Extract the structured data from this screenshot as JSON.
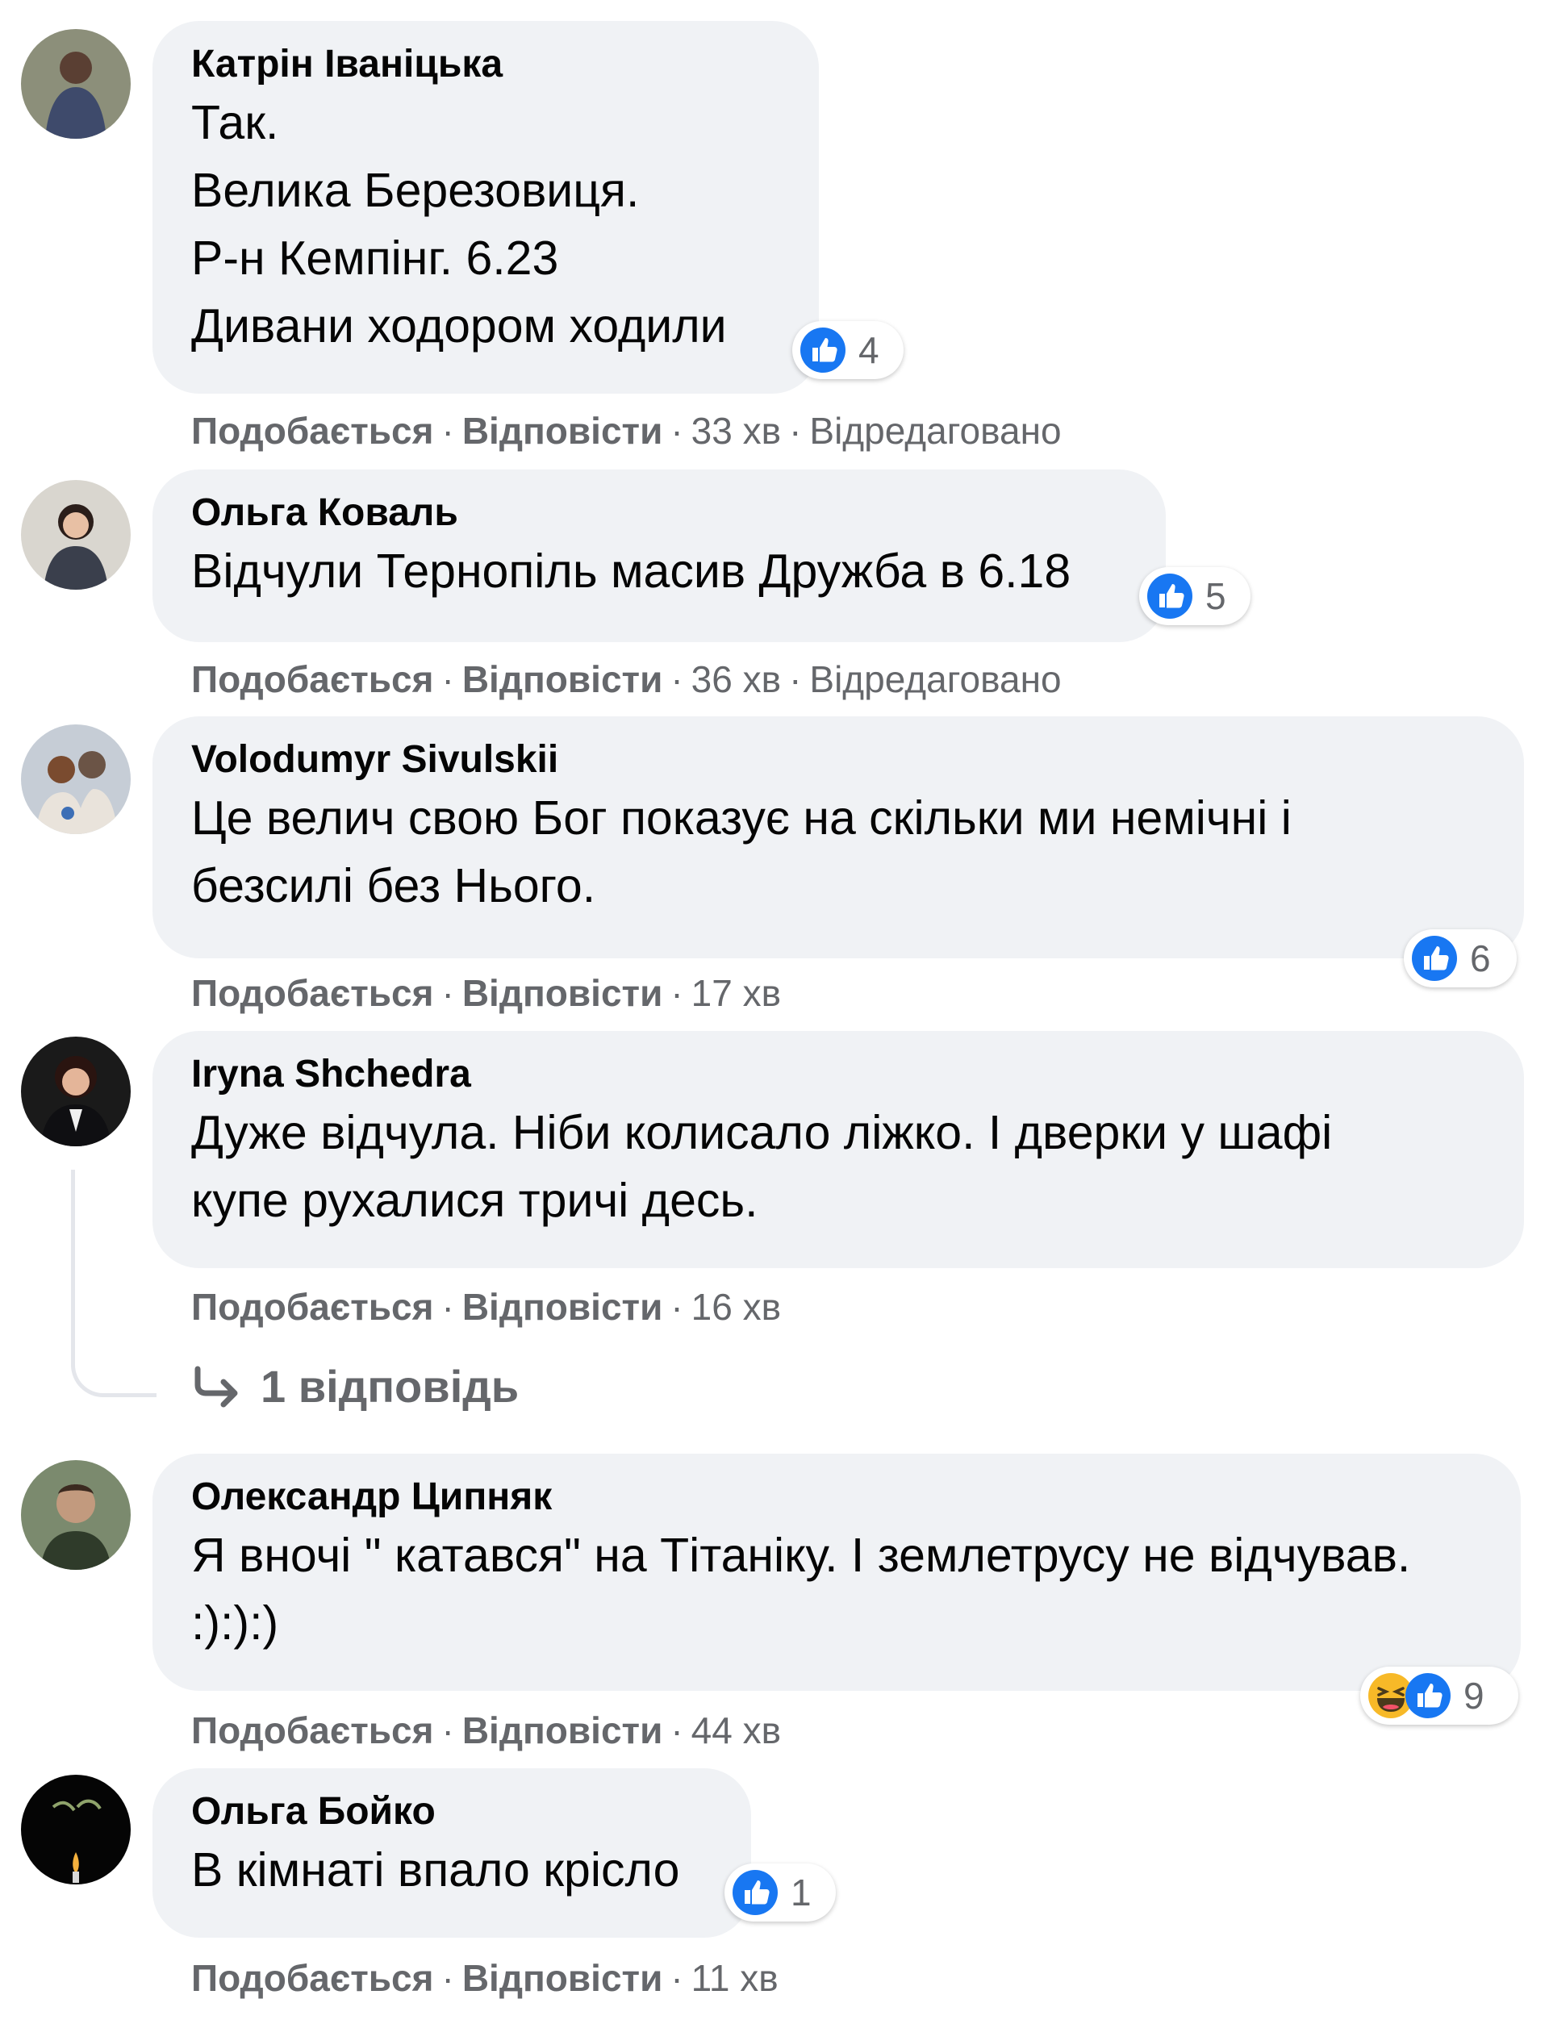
{
  "colors": {
    "bubble": "#f0f2f5",
    "meta": "#65676b",
    "like_blue": "#1877f2",
    "haha_yellow": "#f7b928"
  },
  "comments": [
    {
      "author": "Катрін Іваніцька",
      "text": "Так.\nВелика Березовиця.\nР-н Кемпінг. 6.23\nДивани ходором ходили",
      "reactions": {
        "icons": [
          "like-icon"
        ],
        "count": "4"
      },
      "like_label": "Подобається",
      "reply_label": "Відповісти",
      "time": "33 хв",
      "edited": "Відредаговано"
    },
    {
      "author": "Ольга Коваль",
      "text": "Відчули Тернопіль масив Дружба в 6.18",
      "reactions": {
        "icons": [
          "like-icon"
        ],
        "count": "5"
      },
      "like_label": "Подобається",
      "reply_label": "Відповісти",
      "time": "36 хв",
      "edited": "Відредаговано"
    },
    {
      "author": "Volodumyr Sivulskii",
      "text": "Це велич свою Бог показує на скільки ми немічні і\nбезсилі без Нього.",
      "reactions": {
        "icons": [
          "like-icon"
        ],
        "count": "6"
      },
      "like_label": "Подобається",
      "reply_label": "Відповісти",
      "time": "17 хв"
    },
    {
      "author": "Iryna Shchedra",
      "text": "Дуже відчула. Ніби колисало ліжко. І дверки у шафі\nкупе рухалися тричі десь.",
      "like_label": "Подобається",
      "reply_label": "Відповісти",
      "time": "16 хв",
      "replies_label": "1 відповідь"
    },
    {
      "author": "Олександр Ципняк",
      "text": "Я вночі \" катався\" на Тітаніку. І землетрусу не відчував.\n:):):)",
      "reactions": {
        "icons": [
          "haha-icon",
          "like-icon"
        ],
        "count": "9"
      },
      "like_label": "Подобається",
      "reply_label": "Відповісти",
      "time": "44 хв"
    },
    {
      "author": "Ольга Бойко",
      "text": "В кімнаті впало крісло",
      "reactions": {
        "icons": [
          "like-icon"
        ],
        "count": "1"
      },
      "like_label": "Подобається",
      "reply_label": "Відповісти",
      "time": "11 хв"
    }
  ]
}
